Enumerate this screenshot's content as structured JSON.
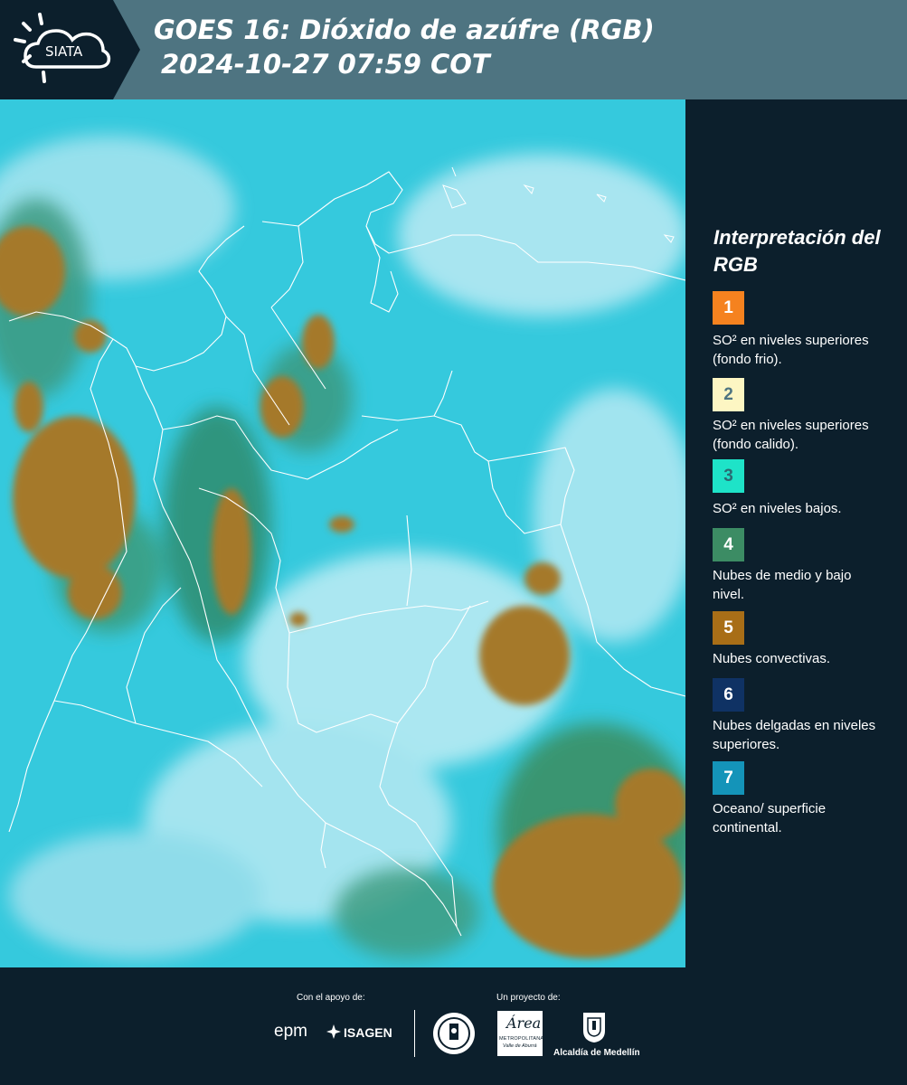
{
  "header": {
    "logo_text": "SIATA",
    "title_line1": "GOES 16: Dióxido de azúfre (RGB)",
    "title_line2": "2024-10-27 07:59 COT"
  },
  "map": {
    "ocean_color": "#35c9dd",
    "convective_color": "#a5792a",
    "boundary_color": "#ffffff"
  },
  "legend": {
    "title": "Interpretación del RGB",
    "items": [
      {
        "number": "1",
        "color": "#f5821f",
        "number_color": "#ffffff",
        "text": "SO² en niveles superiores (fondo frio)."
      },
      {
        "number": "2",
        "color": "#fdf6c3",
        "number_color": "#4e7481",
        "text": "SO² en niveles superiores (fondo calido)."
      },
      {
        "number": "3",
        "color": "#1ee3c8",
        "number_color": "#2a6b73",
        "text": "SO² en niveles bajos."
      },
      {
        "number": "4",
        "color": "#3c8c64",
        "number_color": "#ffffff",
        "text": "Nubes de medio y bajo nivel."
      },
      {
        "number": "5",
        "color": "#a86e17",
        "number_color": "#ffffff",
        "text": "Nubes convectivas."
      },
      {
        "number": "6",
        "color": "#0f3264",
        "number_color": "#ffffff",
        "text": "Nubes delgadas en niveles superiores."
      },
      {
        "number": "7",
        "color": "#1494b9",
        "number_color": "#ffffff",
        "text": "Oceano/ superficie continental."
      }
    ]
  },
  "footer": {
    "support_label": "Con el apoyo de:",
    "project_label": "Un proyecto de:",
    "epm_label": "epm",
    "isagen_label": "ISAGEN",
    "area_label": "Área",
    "area_sub1": "METROPOLITANA",
    "area_sub2": "Valle de Aburrá",
    "alcaldia_label": "Alcaldía de Medellín"
  }
}
